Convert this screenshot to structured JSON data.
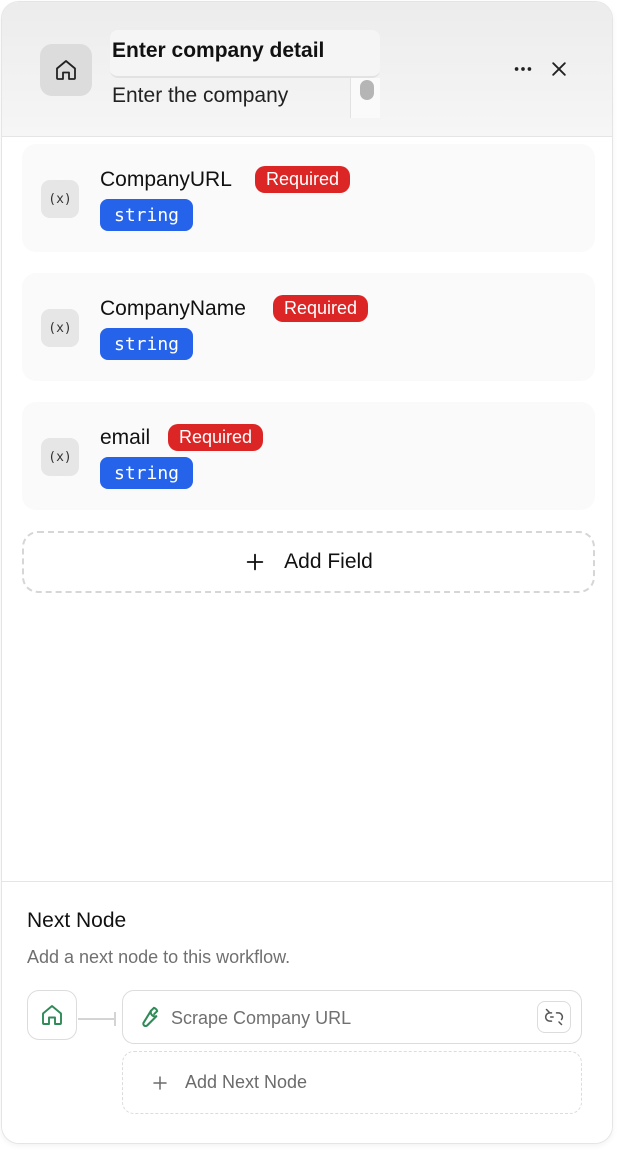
{
  "header": {
    "title": "Enter company detail",
    "description": "Enter the company",
    "icons": {
      "node": "home-icon",
      "more": "more-horizontal-icon",
      "close": "close-icon"
    }
  },
  "fields": [
    {
      "name": "CompanyURL",
      "required_label": "Required",
      "type": "string",
      "icon": "variable-icon"
    },
    {
      "name": "CompanyName",
      "required_label": "Required",
      "type": "string",
      "icon": "variable-icon"
    },
    {
      "name": "email",
      "required_label": "Required",
      "type": "string",
      "icon": "variable-icon"
    }
  ],
  "add_field": {
    "label": "Add Field",
    "icon": "plus-icon"
  },
  "next_node": {
    "title": "Next Node",
    "description": "Add a next node to this workflow.",
    "node": {
      "label": "Scrape Company URL",
      "icon": "wrench-icon",
      "action_icon": "unlink-icon"
    },
    "add_label": "Add Next Node"
  },
  "colors": {
    "required": "#dc2626",
    "type_badge": "#2563eb",
    "home_icon_green": "#2e8b57"
  }
}
